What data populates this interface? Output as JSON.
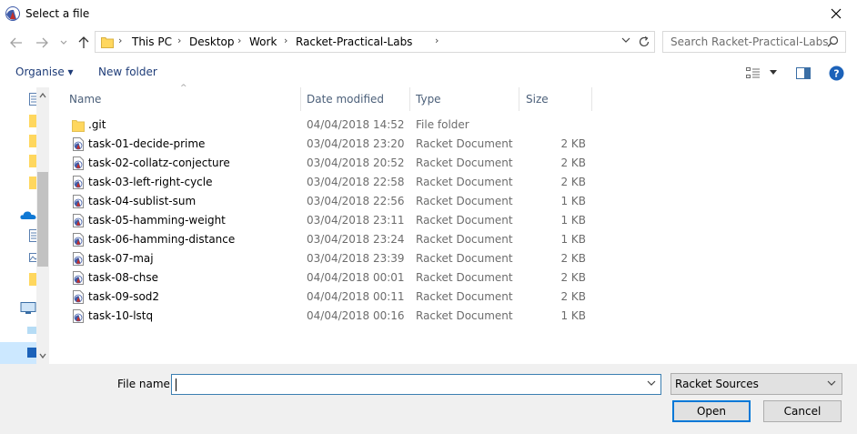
{
  "window": {
    "title": "Select a file"
  },
  "nav": {
    "breadcrumbs": [
      "This PC",
      "Desktop",
      "Work",
      "Racket-Practical-Labs"
    ],
    "search_placeholder": "Search Racket-Practical-Labs"
  },
  "toolbar": {
    "organise_label": "Organise ▾",
    "new_folder_label": "New folder"
  },
  "columns": {
    "name": "Name",
    "date": "Date modified",
    "type": "Type",
    "size": "Size"
  },
  "files": [
    {
      "name": ".git",
      "date": "04/04/2018 14:52",
      "type": "File folder",
      "size": "",
      "kind": "folder"
    },
    {
      "name": "task-01-decide-prime",
      "date": "03/04/2018 23:20",
      "type": "Racket Document",
      "size": "2 KB",
      "kind": "racket"
    },
    {
      "name": "task-02-collatz-conjecture",
      "date": "03/04/2018 20:52",
      "type": "Racket Document",
      "size": "2 KB",
      "kind": "racket"
    },
    {
      "name": "task-03-left-right-cycle",
      "date": "03/04/2018 22:58",
      "type": "Racket Document",
      "size": "2 KB",
      "kind": "racket"
    },
    {
      "name": "task-04-sublist-sum",
      "date": "03/04/2018 22:56",
      "type": "Racket Document",
      "size": "1 KB",
      "kind": "racket"
    },
    {
      "name": "task-05-hamming-weight",
      "date": "03/04/2018 23:11",
      "type": "Racket Document",
      "size": "1 KB",
      "kind": "racket"
    },
    {
      "name": "task-06-hamming-distance",
      "date": "03/04/2018 23:24",
      "type": "Racket Document",
      "size": "1 KB",
      "kind": "racket"
    },
    {
      "name": "task-07-maj",
      "date": "03/04/2018 23:39",
      "type": "Racket Document",
      "size": "2 KB",
      "kind": "racket"
    },
    {
      "name": "task-08-chse",
      "date": "04/04/2018 00:01",
      "type": "Racket Document",
      "size": "2 KB",
      "kind": "racket"
    },
    {
      "name": "task-09-sod2",
      "date": "04/04/2018 00:11",
      "type": "Racket Document",
      "size": "2 KB",
      "kind": "racket"
    },
    {
      "name": "task-10-lstq",
      "date": "04/04/2018 00:16",
      "type": "Racket Document",
      "size": "1 KB",
      "kind": "racket"
    }
  ],
  "bottom": {
    "filename_label": "File name:",
    "filename_value": "",
    "filter_value": "Racket Sources",
    "open_label": "Open",
    "cancel_label": "Cancel"
  },
  "colors": {
    "accent": "#0078d7",
    "link_text": "#1e3c78",
    "folder_yellow": "#ffd75e",
    "racket_red": "#c4302b",
    "racket_blue": "#3e5ba9"
  }
}
